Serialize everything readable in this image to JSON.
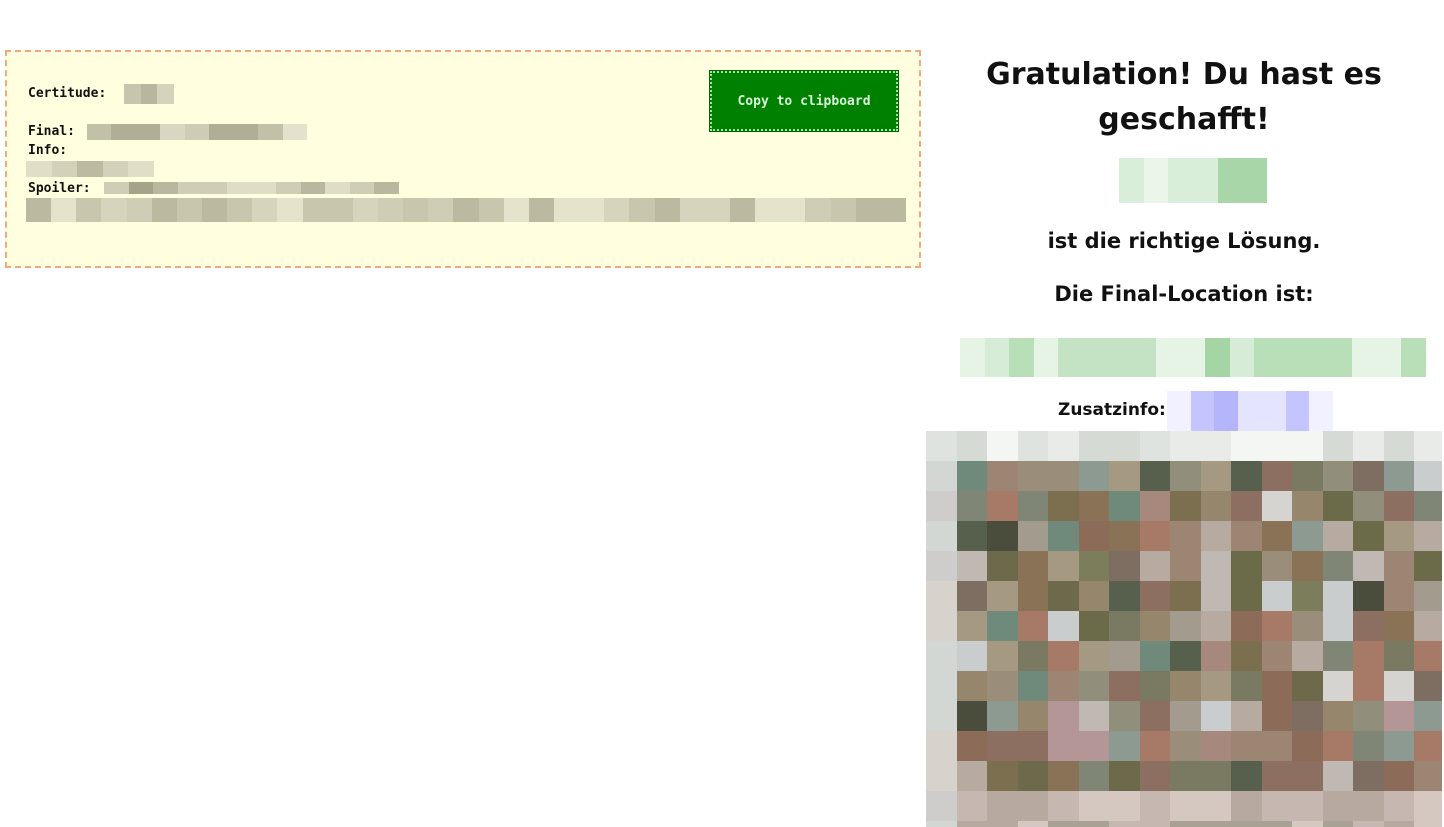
{
  "infobox": {
    "certitude_label": "Certitude:",
    "final_label": "Final:",
    "info_label": "Info:",
    "spoiler_label": "Spoiler:",
    "copy_button_label": "Copy to clipboard"
  },
  "result": {
    "headline": "Gratulation! Du hast es geschafft!",
    "solution_suffix": "ist die richtige Lösung.",
    "final_location_label": "Die Final-Location ist:",
    "extra_info_label": "Zusatzinfo:"
  },
  "colors": {
    "box_background": "#ffffdf",
    "box_border": "#f4a97c",
    "button_background": "#008000",
    "button_text": "#d8f3d8"
  }
}
